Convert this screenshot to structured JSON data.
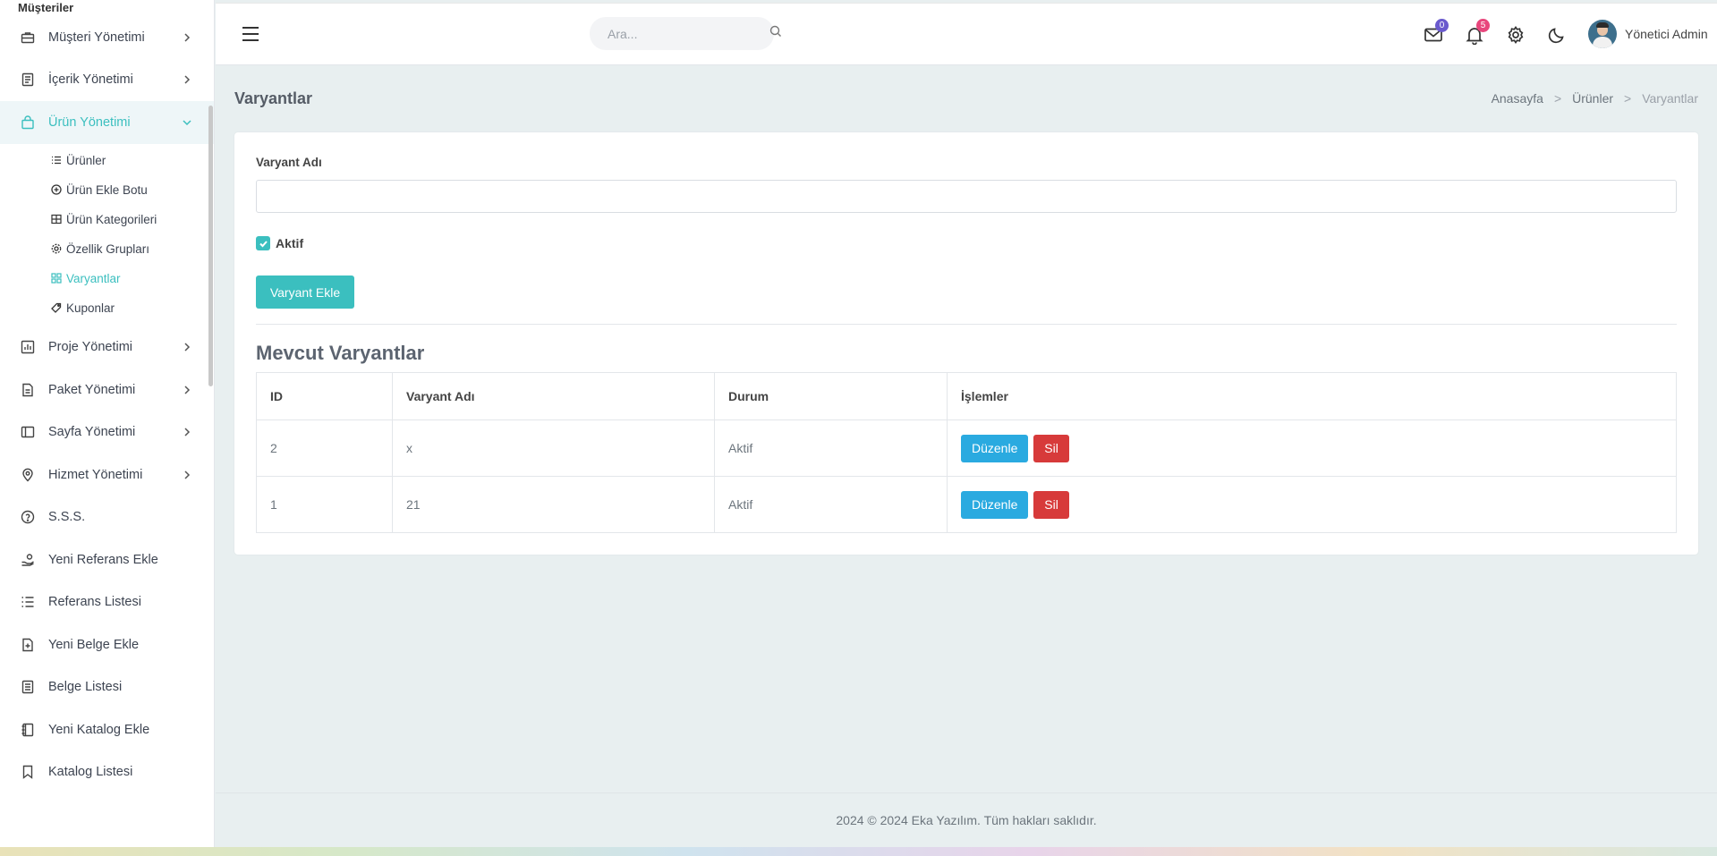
{
  "sidebar": {
    "top_label": "Müşteriler",
    "items": [
      {
        "label": "Müşteri Yönetimi",
        "icon": "briefcase-icon",
        "has_chevron": true
      },
      {
        "label": "İçerik Yönetimi",
        "icon": "document-icon",
        "has_chevron": true
      },
      {
        "label": "Ürün Yönetimi",
        "icon": "bag-icon",
        "has_chevron": true,
        "expanded": true
      },
      {
        "label": "Proje Yönetimi",
        "icon": "chart-icon",
        "has_chevron": true
      },
      {
        "label": "Paket Yönetimi",
        "icon": "file-icon",
        "has_chevron": true
      },
      {
        "label": "Sayfa Yönetimi",
        "icon": "layout-icon",
        "has_chevron": true
      },
      {
        "label": "Hizmet Yönetimi",
        "icon": "location-pin-icon",
        "has_chevron": true
      },
      {
        "label": "S.S.S.",
        "icon": "question-circle-icon",
        "has_chevron": false
      },
      {
        "label": "Yeni Referans Ekle",
        "icon": "hand-coin-icon",
        "has_chevron": false
      },
      {
        "label": "Referans Listesi",
        "icon": "list-icon",
        "has_chevron": false
      },
      {
        "label": "Yeni Belge Ekle",
        "icon": "file-plus-icon",
        "has_chevron": false
      },
      {
        "label": "Belge Listesi",
        "icon": "file-text-icon",
        "has_chevron": false
      },
      {
        "label": "Yeni Katalog Ekle",
        "icon": "book-icon",
        "has_chevron": false
      },
      {
        "label": "Katalog Listesi",
        "icon": "bookmark-icon",
        "has_chevron": false
      }
    ],
    "submenu": [
      {
        "label": "Ürünler",
        "icon": "list-icon"
      },
      {
        "label": "Ürün Ekle Botu",
        "icon": "plus-circle-icon"
      },
      {
        "label": "Ürün Kategorileri",
        "icon": "grid-icon"
      },
      {
        "label": "Özellik Grupları",
        "icon": "settings-icon"
      },
      {
        "label": "Varyantlar",
        "icon": "apps-icon",
        "active": true
      },
      {
        "label": "Kuponlar",
        "icon": "tag-icon"
      }
    ]
  },
  "header": {
    "search_placeholder": "Ara...",
    "mail_count": "0",
    "notification_count": "5",
    "user_name": "Yönetici Admin",
    "colors": {
      "mail_badge": "#6a5acd",
      "notif_badge": "#e8467c"
    }
  },
  "page": {
    "title": "Varyantlar",
    "breadcrumb": [
      "Anasayfa",
      "Ürünler",
      "Varyantlar"
    ]
  },
  "form": {
    "label": "Varyant Adı",
    "value": "",
    "checkbox_label": "Aktif",
    "checkbox_checked": true,
    "submit_label": "Varyant Ekle"
  },
  "table": {
    "title": "Mevcut Varyantlar",
    "headers": [
      "ID",
      "Varyant Adı",
      "Durum",
      "İşlemler"
    ],
    "rows": [
      {
        "id": "2",
        "name": "x",
        "status": "Aktif"
      },
      {
        "id": "1",
        "name": "21",
        "status": "Aktif"
      }
    ],
    "edit_label": "Düzenle",
    "delete_label": "Sil"
  },
  "footer": {
    "text": "2024 © 2024 Eka Yazılım. Tüm hakları saklıdır."
  },
  "colors": {
    "accent": "#3bbfbf",
    "edit": "#2aaae0",
    "delete": "#d73a3a",
    "background": "#e8eff0"
  }
}
